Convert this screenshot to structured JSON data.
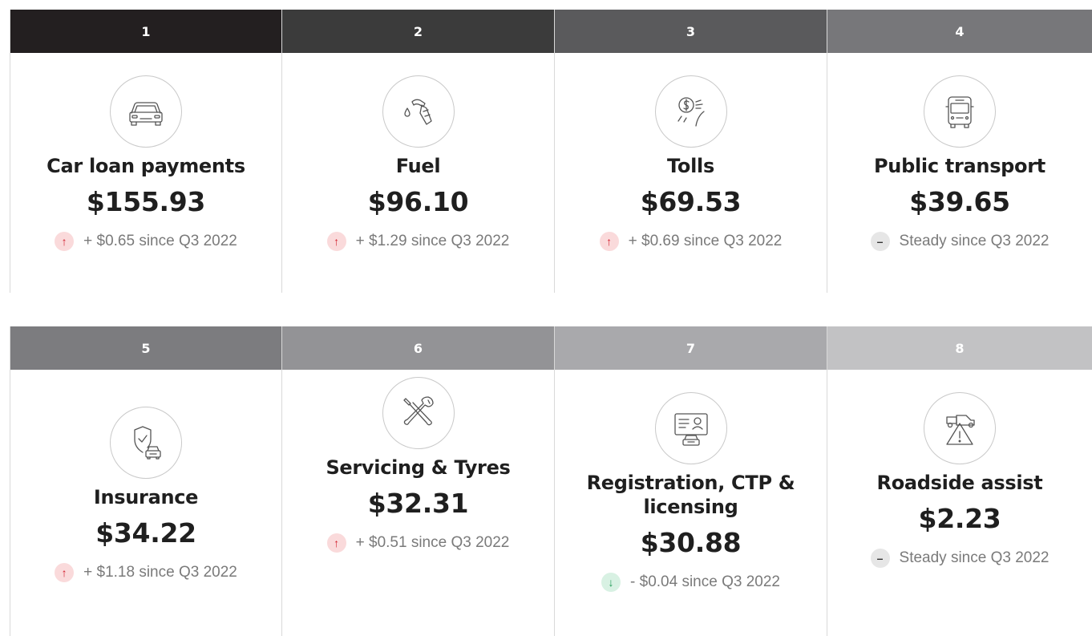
{
  "colors": {
    "header_1": "#231f20",
    "header_2": "#3b3b3b",
    "header_3": "#5a5a5c",
    "header_4": "#77777a",
    "header_5": "#7c7c7f",
    "header_6": "#939396",
    "header_7": "#a9a9ac",
    "header_8": "#c2c2c4",
    "up": "#d21f2d",
    "down": "#239b58"
  },
  "cards": [
    {
      "rank": "1",
      "icon": "car-icon",
      "title": "Car loan payments",
      "amount": "$155.93",
      "trend": "up",
      "change": "+ $0.65 since Q3 2022"
    },
    {
      "rank": "2",
      "icon": "fuel-nozzle-icon",
      "title": "Fuel",
      "amount": "$96.10",
      "trend": "up",
      "change": "+ $1.29 since Q3 2022"
    },
    {
      "rank": "3",
      "icon": "toll-icon",
      "title": "Tolls",
      "amount": "$69.53",
      "trend": "up",
      "change": "+ $0.69 since Q3 2022"
    },
    {
      "rank": "4",
      "icon": "bus-icon",
      "title": "Public transport",
      "amount": "$39.65",
      "trend": "steady",
      "change": "Steady since Q3 2022"
    },
    {
      "rank": "5",
      "icon": "insurance-shield-car-icon",
      "title": "Insurance",
      "amount": "$34.22",
      "trend": "up",
      "change": "+ $1.18 since Q3 2022"
    },
    {
      "rank": "6",
      "icon": "wrench-screwdriver-icon",
      "title": "Servicing & Tyres",
      "amount": "$32.31",
      "trend": "up",
      "change": "+ $0.51 since Q3 2022"
    },
    {
      "rank": "7",
      "icon": "licence-card-car-icon",
      "title": "Registration, CTP & licensing",
      "amount": "$30.88",
      "trend": "down",
      "change": "- $0.04 since Q3 2022"
    },
    {
      "rank": "8",
      "icon": "roadside-warning-icon",
      "title": "Roadside assist",
      "amount": "$2.23",
      "trend": "steady",
      "change": "Steady since Q3 2022"
    }
  ],
  "trend_glyphs": {
    "up": "↑",
    "down": "↓",
    "steady": "–"
  }
}
